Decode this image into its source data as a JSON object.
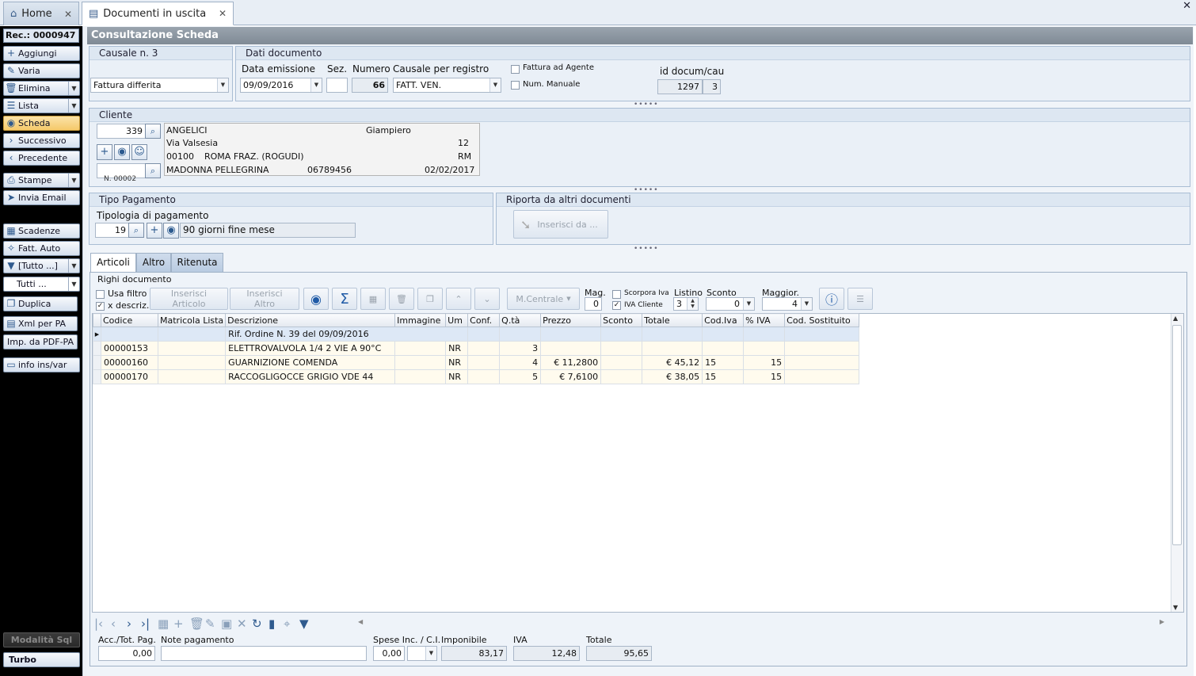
{
  "tabs": {
    "home": "Home",
    "doc": "Documenti in uscita",
    "close": "✕"
  },
  "window_close": "✕",
  "sidebar": {
    "rec_label": "Rec.: 0000947",
    "buttons": [
      "Aggiungi",
      "Varia",
      "Elimina",
      "Lista",
      "Scheda",
      "Successivo",
      "Precedente",
      "Stampe",
      "Invia Email",
      "Scadenze",
      "Fatt. Auto",
      "[Tutto ...]",
      "Tutti ...",
      "Duplica",
      "Xml per PA",
      "Imp. da PDF-PA",
      "info ins/var"
    ],
    "modalita": "Modalità Sql",
    "turbo": "Turbo"
  },
  "title": "Consultazione Scheda",
  "causale": {
    "group": "Causale n. 3",
    "value": "Fattura differita"
  },
  "dati": {
    "group": "Dati documento",
    "data_label": "Data emissione",
    "data_value": "09/09/2016",
    "sez_label": "Sez.",
    "sez_value": "",
    "numero_label": "Numero",
    "numero_value": "66",
    "causale_reg_label": "Causale per registro",
    "causale_reg_value": "FATT. VEN.",
    "fattura_agente": "Fattura ad Agente",
    "num_manuale": "Num. Manuale",
    "id_label": "id docum/cau",
    "id_value": "1297",
    "cau_value": "3"
  },
  "cliente": {
    "group": "Cliente",
    "code": "339",
    "surname": "ANGELICI",
    "name": "Giampiero",
    "street": "Via Valsesia",
    "civic": "12",
    "cap": "00100",
    "city": "ROMA FRAZ. (ROGUDI)",
    "prov": "RM",
    "locality": "MADONNA PELLEGRINA",
    "phone": "06789456",
    "date": "02/02/2017",
    "sub_label": "N. 00002"
  },
  "pagamento": {
    "group": "Tipo Pagamento",
    "tipologia_label": "Tipologia di pagamento",
    "code": "19",
    "desc": "90 giorni fine mese"
  },
  "riporta": {
    "group": "Riporta da altri documenti",
    "btn": "Inserisci da ..."
  },
  "art_tabs": [
    "Articoli",
    "Altro",
    "Ritenuta"
  ],
  "righi": {
    "title": "Righi documento",
    "usa_filtro": "Usa filtro",
    "x_descriz": "x descriz.",
    "ins_articolo": [
      "Inserisci",
      "Articolo"
    ],
    "ins_altro": [
      "Inserisci",
      "Altro"
    ],
    "m_centrale": "M.Centrale",
    "mag_label": "Mag.",
    "mag_value": "0",
    "scorpora": "Scorpora Iva",
    "iva_cliente": "IVA Cliente",
    "listino_label": "Listino",
    "listino_value": "3",
    "sconto_label": "Sconto",
    "sconto_value": "0",
    "maggior_label": "Maggior.",
    "maggior_value": "4",
    "icons": {
      "eye": "eye-icon",
      "sigma": "sigma-icon",
      "help": "help-icon"
    }
  },
  "grid": {
    "columns": [
      "Codice",
      "Matricola Lista",
      "Descrizione",
      "Immagine",
      "Um",
      "Conf.",
      "Q.tà",
      "Prezzo",
      "Sconto",
      "Totale",
      "Cod.Iva",
      "% IVA",
      "Cod. Sostituito"
    ],
    "rif_row": "Rif. Ordine N. 39 del 09/09/2016",
    "rows": [
      {
        "codice": "00000153",
        "descrizione": "ELETTROVALVOLA 1/4 2 VIE A 90°C",
        "um": "NR",
        "qta": "3",
        "prezzo": "",
        "totale": "",
        "codiva": "",
        "iva": ""
      },
      {
        "codice": "00000160",
        "descrizione": "GUARNIZIONE COMENDA",
        "um": "NR",
        "qta": "4",
        "prezzo": "€ 11,2800",
        "totale": "€ 45,12",
        "codiva": "15",
        "iva": "15"
      },
      {
        "codice": "00000170",
        "descrizione": "RACCOGLIGOCCE GRIGIO VDE 44",
        "um": "NR",
        "qta": "5",
        "prezzo": "€ 7,6100",
        "totale": "€ 38,05",
        "codiva": "15",
        "iva": "15"
      }
    ]
  },
  "footer": {
    "acc_label": "Acc./Tot. Pag.",
    "acc_value": "0,00",
    "note_label": "Note pagamento",
    "note_value": "",
    "spese_label": "Spese Inc. / C.I.",
    "spese_value": "0,00",
    "imponibile_label": "Imponibile",
    "imponibile_value": "83,17",
    "iva_label": "IVA",
    "iva_value": "12,48",
    "totale_label": "Totale",
    "totale_value": "95,65"
  }
}
